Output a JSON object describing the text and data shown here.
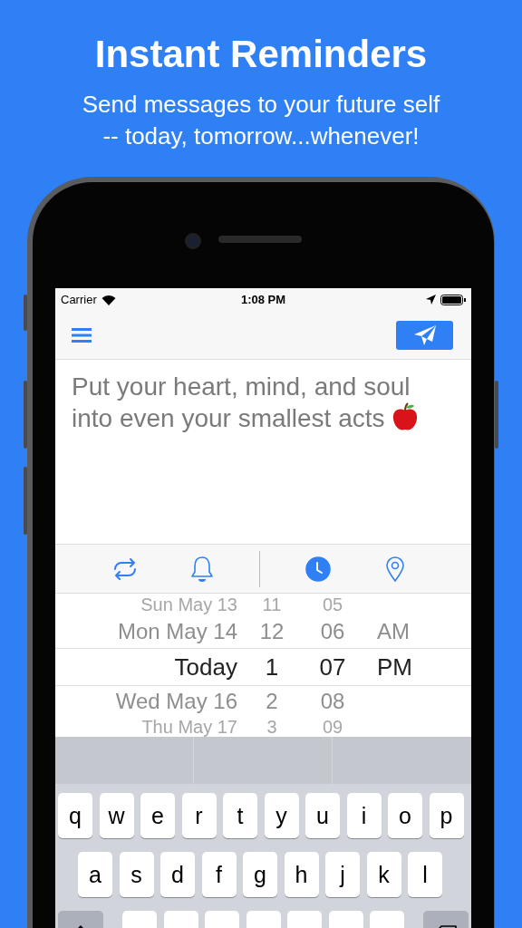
{
  "header": {
    "title": "Instant Reminders",
    "subtitle_lines": [
      "Send messages to your future self",
      "-- today, tomorrow...whenever!"
    ]
  },
  "status_bar": {
    "carrier": "Carrier",
    "time": "1:08 PM"
  },
  "message": {
    "value": "Put your heart, mind, and soul into even your smallest acts"
  },
  "toolbar": [
    {
      "kind": "repeat",
      "selected": false
    },
    {
      "kind": "bell",
      "selected": false
    },
    {
      "kind": "clock",
      "selected": true
    },
    {
      "kind": "location",
      "selected": false
    }
  ],
  "picker": {
    "rows": [
      {
        "date": "Sun May 13",
        "hour": "11",
        "minute": "05",
        "selected": false
      },
      {
        "date": "Mon May 14",
        "hour": "12",
        "minute": "06",
        "period": "AM",
        "selected": false
      },
      {
        "date": "Today",
        "hour": "1",
        "minute": "07",
        "period": "PM",
        "selected": true
      },
      {
        "date": "Wed May 16",
        "hour": "2",
        "minute": "08",
        "selected": false
      },
      {
        "date": "Thu May 17",
        "hour": "3",
        "minute": "09",
        "selected": false
      }
    ]
  },
  "keyboard": {
    "rows": [
      [
        "q",
        "w",
        "e",
        "r",
        "t",
        "y",
        "u",
        "i",
        "o",
        "p"
      ],
      [
        "a",
        "s",
        "d",
        "f",
        "g",
        "h",
        "j",
        "k",
        "l"
      ]
    ]
  }
}
